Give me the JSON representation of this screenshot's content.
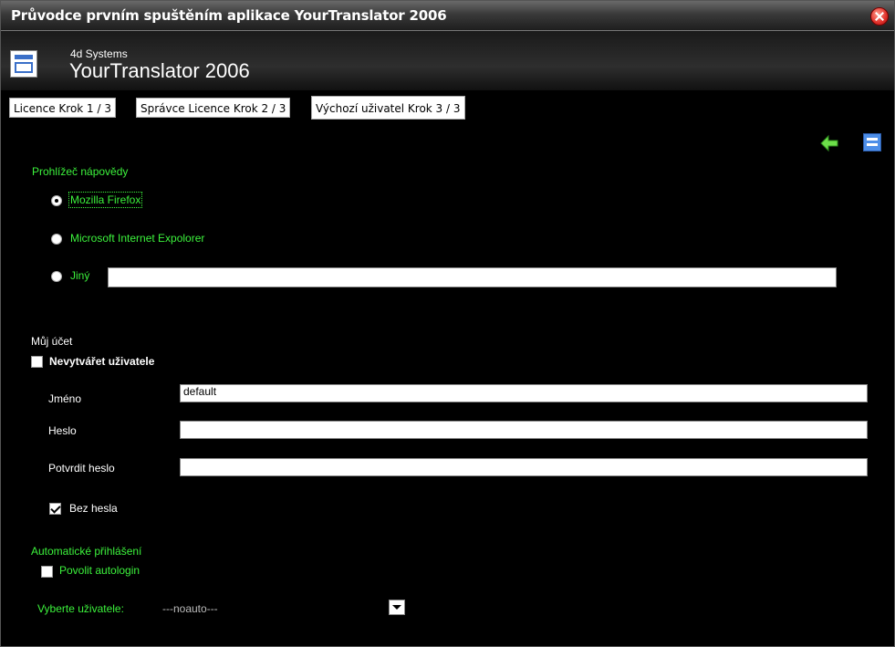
{
  "window": {
    "title": "Průvodce prvním spuštěním aplikace YourTranslator 2006",
    "company": "4d Systems",
    "app_name": "YourTranslator 2006"
  },
  "tabs": [
    {
      "label": "Licence Krok 1 / 3",
      "active": false
    },
    {
      "label": "Správce Licence Krok 2 / 3",
      "active": false
    },
    {
      "label": "Výchozí uživatel Krok 3 / 3",
      "active": true
    }
  ],
  "toolbar": {
    "back_icon": "back-arrow-icon",
    "save_icon": "save-icon"
  },
  "help_viewer": {
    "section_title": "Prohlížeč nápovědy",
    "options": [
      {
        "label": "Mozilla Firefox",
        "selected": true
      },
      {
        "label": "Microsoft Internet Expolorer",
        "selected": false
      },
      {
        "label": "Jiný",
        "selected": false
      }
    ],
    "other_path_value": ""
  },
  "account": {
    "section_title": "Můj účet",
    "no_create_user_label": "Nevytvářet uživatele",
    "no_create_user_checked": false,
    "name_label": "Jméno",
    "name_value": "default",
    "password_label": "Heslo",
    "password_value": "",
    "confirm_password_label": "Potvrdit heslo",
    "confirm_password_value": "",
    "no_password_label": "Bez hesla",
    "no_password_checked": true
  },
  "autologin": {
    "section_title": "Automatické přihlášení",
    "enable_label": "Povolit autologin",
    "enable_checked": false,
    "select_user_label": "Vyberte uživatele:",
    "select_user_value": "---noauto---"
  },
  "colors": {
    "accent_green": "#3cf23c",
    "background": "#000000",
    "save_icon_blue": "#4d8ee8"
  }
}
